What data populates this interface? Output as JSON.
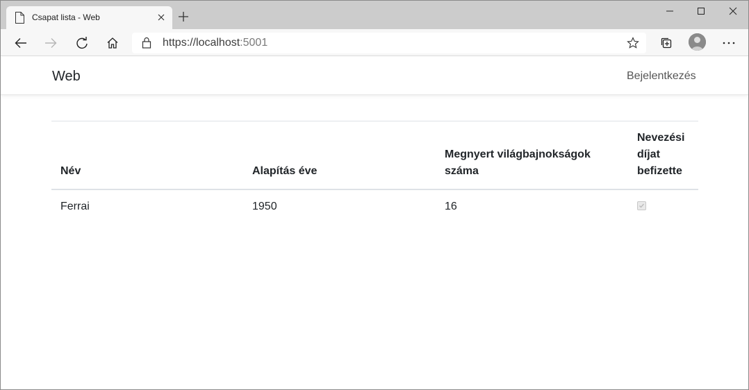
{
  "browser": {
    "tab_title": "Csapat lista - Web",
    "url_host": "https://localhost",
    "url_rest": ":5001"
  },
  "navbar": {
    "brand": "Web",
    "login": "Bejelentkezés"
  },
  "table": {
    "headers": [
      "Név",
      "Alapítás éve",
      "Megnyert világbajnokságok száma",
      "Nevezési díjat befizette"
    ],
    "rows": [
      {
        "name": "Ferrai",
        "founded": "1950",
        "championships": "16",
        "fee_paid": true
      }
    ]
  }
}
